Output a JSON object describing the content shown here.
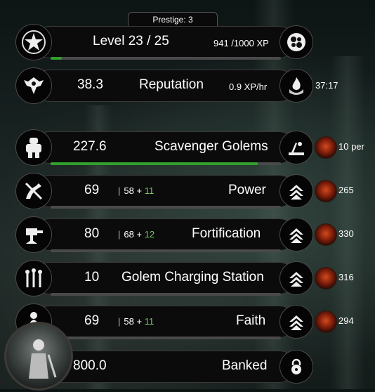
{
  "prestige": {
    "label": "Prestige: 3"
  },
  "level": {
    "label": "Level 23 / 25",
    "xp": "941 /1000 XP",
    "progress": 0.05
  },
  "reputation": {
    "value": "38.3",
    "label": "Reputation",
    "rate": "0.9 XP/hr",
    "timer": "37:17"
  },
  "golems": {
    "value": "227.6",
    "label": "Scavenger Golems",
    "progress": 0.9,
    "cost": "10 per"
  },
  "upgrades": [
    {
      "name": "power",
      "value": "69",
      "base": "58",
      "bonus": "11",
      "label": "Power",
      "cost": "265"
    },
    {
      "name": "fortification",
      "value": "80",
      "base": "68",
      "bonus": "12",
      "label": "Fortification",
      "cost": "330"
    },
    {
      "name": "charging",
      "value": "10",
      "label": "Golem Charging Station",
      "cost": "316"
    },
    {
      "name": "faith",
      "value": "69",
      "base": "58",
      "bonus": "11",
      "label": "Faith",
      "cost": "294"
    }
  ],
  "banked": {
    "value": "800.0",
    "label": "Banked"
  },
  "icons": {
    "level": "star-emblem-icon",
    "xp": "orbs-icon",
    "reputation": "winged-emblem-icon",
    "rate": "fire-hand-icon",
    "golem": "golem-icon",
    "golem_action": "workshop-icon",
    "upgrade": "chevron-up-icon",
    "currency": "demon-face-icon",
    "power": "crossed-arm-icon",
    "fortification": "turret-icon",
    "charging": "tesla-coil-icon",
    "faith": "praying-figure-icon",
    "banked": "padlock-icon"
  },
  "colors": {
    "progress": "#31a02c",
    "bonus": "#7cc86a"
  }
}
